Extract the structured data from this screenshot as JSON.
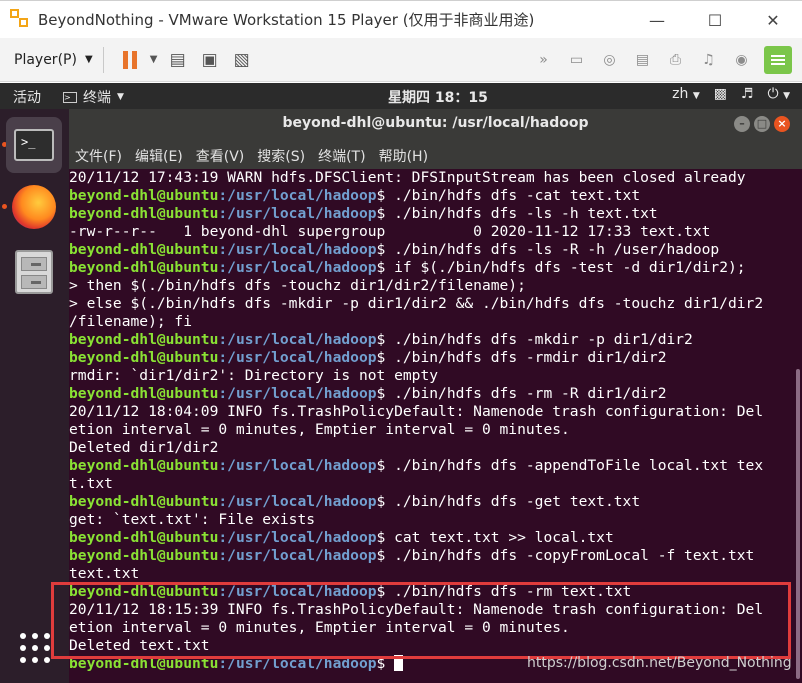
{
  "vm_window": {
    "title": "BeyondNothing - VMware Workstation 15 Player (仅用于非商业用途)"
  },
  "vm_toolbar": {
    "player_menu": "Player(P)"
  },
  "ubuntu_topbar": {
    "activities": "活动",
    "app_name": "终端",
    "clock": "星期四 18：15",
    "input_method": "zh"
  },
  "terminal": {
    "title": "beyond-dhl@ubuntu: /usr/local/hadoop",
    "menu": [
      "文件(F)",
      "编辑(E)",
      "查看(V)",
      "搜索(S)",
      "终端(T)",
      "帮助(H)"
    ],
    "prompt_user": "beyond-dhl@ubuntu",
    "prompt_path": ":/usr/local/hadoop",
    "lines": [
      {
        "text": "20/11/12 17:43:19 WARN hdfs.DFSClient: DFSInputStream has been closed already"
      },
      {
        "cmd": "$ ./bin/hdfs dfs -cat text.txt"
      },
      {
        "cmd": "$ ./bin/hdfs dfs -ls -h text.txt"
      },
      {
        "text": "-rw-r--r--   1 beyond-dhl supergroup          0 2020-11-12 17:33 text.txt"
      },
      {
        "cmd": "$ ./bin/hdfs dfs -ls -R -h /user/hadoop"
      },
      {
        "cmd": "$ if $(./bin/hdfs dfs -test -d dir1/dir2);"
      },
      {
        "text": "> then $(./bin/hdfs dfs -touchz dir1/dir2/filename);"
      },
      {
        "text": "> else $(./bin/hdfs dfs -mkdir -p dir1/dir2 && ./bin/hdfs dfs -touchz dir1/dir2"
      },
      {
        "text": "/filename); fi"
      },
      {
        "cmd": "$ ./bin/hdfs dfs -mkdir -p dir1/dir2"
      },
      {
        "cmd": "$ ./bin/hdfs dfs -rmdir dir1/dir2"
      },
      {
        "text": "rmdir: `dir1/dir2': Directory is not empty"
      },
      {
        "cmd": "$ ./bin/hdfs dfs -rm -R dir1/dir2"
      },
      {
        "text": "20/11/12 18:04:09 INFO fs.TrashPolicyDefault: Namenode trash configuration: Del"
      },
      {
        "text": "etion interval = 0 minutes, Emptier interval = 0 minutes."
      },
      {
        "text": "Deleted dir1/dir2"
      },
      {
        "cmd": "$ ./bin/hdfs dfs -appendToFile local.txt tex"
      },
      {
        "text": "t.txt"
      },
      {
        "cmd": "$ ./bin/hdfs dfs -get text.txt"
      },
      {
        "text": "get: `text.txt': File exists"
      },
      {
        "cmd": "$ cat text.txt >> local.txt"
      },
      {
        "cmd": "$ ./bin/hdfs dfs -copyFromLocal -f text.txt"
      },
      {
        "text": "text.txt"
      },
      {
        "cmd": "$ ./bin/hdfs dfs -rm text.txt"
      },
      {
        "text": "20/11/12 18:15:39 INFO fs.TrashPolicyDefault: Namenode trash configuration: Del"
      },
      {
        "text": "etion interval = 0 minutes, Emptier interval = 0 minutes."
      },
      {
        "text": "Deleted text.txt"
      },
      {
        "cmd": "$ ",
        "cursor": true
      }
    ]
  },
  "watermark": "https://blog.csdn.net/Beyond_Nothing",
  "colors": {
    "terminal_bg": "#300a24",
    "prompt_user": "#8ae234",
    "prompt_path": "#729fcf",
    "highlight_box": "#e03c3c"
  }
}
